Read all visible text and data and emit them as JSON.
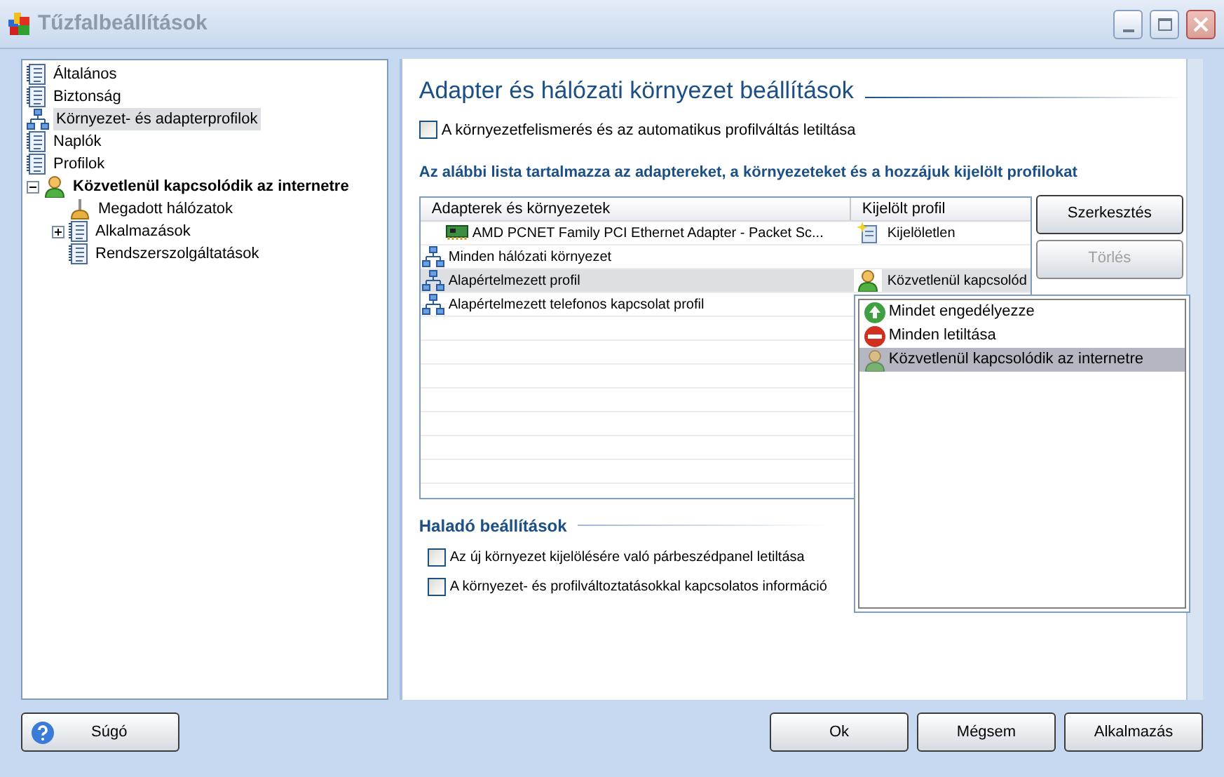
{
  "window": {
    "title": "Tűzfalbeállítások"
  },
  "tree": [
    {
      "label": "Általános",
      "kind": "page",
      "selected": false
    },
    {
      "label": "Biztonság",
      "kind": "page",
      "selected": false
    },
    {
      "label": "Környezet- és adapterprofilok",
      "kind": "network",
      "selected": true
    },
    {
      "label": "Naplók",
      "kind": "page",
      "selected": false
    },
    {
      "label": "Profilok",
      "kind": "page",
      "selected": false
    },
    {
      "label": "Közvetlenül kapcsolódik az internetre",
      "kind": "profile",
      "selected": false,
      "expanded": true,
      "children": [
        {
          "label": "Megadott hálózatok",
          "kind": "plug",
          "selected": false
        },
        {
          "label": "Alkalmazások",
          "kind": "page",
          "selected": false,
          "expanded": false
        },
        {
          "label": "Rendszerszolgáltatások",
          "kind": "page",
          "selected": false
        }
      ]
    }
  ],
  "main": {
    "title": "Adapter és hálózati környezet beállítások",
    "disable_detection": {
      "label": "A környezetfelismerés és az automatikus profilváltás letiltása",
      "checked": false
    },
    "list_caption": "Az alábbi lista tartalmazza az adaptereket, a környezeteket és a hozzájuk kijelölt profilokat",
    "table": {
      "columns": [
        "Adapterek és környezetek",
        "Kijelölt profil"
      ],
      "rows": [
        {
          "name": "AMD PCNET Family PCI Ethernet Adapter - Packet Sc...",
          "kind": "adapter",
          "selected": false,
          "profile": {
            "label": "Kijelöletlen",
            "kind": "unassigned"
          }
        },
        {
          "name": "Minden hálózati környezet",
          "kind": "environment",
          "selected": false
        },
        {
          "name": "Alapértelmezett profil",
          "kind": "environment",
          "selected": true,
          "profile": {
            "label": "Közvetlenül kapcsolód",
            "kind": "direct"
          }
        },
        {
          "name": "Alapértelmezett telefonos kapcsolat profil",
          "kind": "environment",
          "selected": false
        }
      ]
    },
    "buttons": [
      {
        "label": "Szerkesztés",
        "disabled": false
      },
      {
        "label": "Törlés",
        "disabled": true
      }
    ],
    "profile_dropdown": {
      "items": [
        {
          "label": "Mindet engedélyezze",
          "kind": "allow",
          "selected": false
        },
        {
          "label": "Minden letiltása",
          "kind": "block",
          "selected": false
        },
        {
          "label": "Közvetlenül kapcsolódik az internetre",
          "kind": "direct",
          "selected": true
        }
      ]
    },
    "advanced": {
      "title": "Haladó beállítások",
      "options": [
        {
          "label": "Az új környezet kijelölésére való párbeszédpanel letiltása",
          "checked": false
        },
        {
          "label": "A környezet- és profilváltoztatásokkal kapcsolatos információ",
          "checked": false
        }
      ]
    }
  },
  "footer": {
    "help": "Súgó",
    "buttons": [
      "Ok",
      "Mégsem",
      "Alkalmazás"
    ]
  }
}
